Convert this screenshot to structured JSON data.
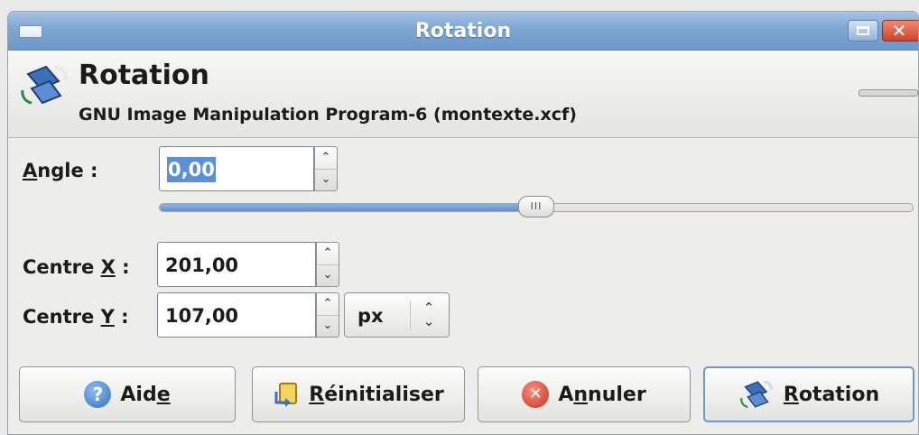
{
  "window": {
    "title": "Rotation",
    "close_glyph": "✕"
  },
  "header": {
    "title": "Rotation",
    "subtitle": "GNU Image Manipulation Program-6 (montexte.xcf)",
    "icon": "rotate-tool-icon"
  },
  "angle": {
    "label_mnemonic": "A",
    "label_rest": "ngle :",
    "value": "0,00",
    "slider_fraction": 0.5,
    "slider_grip": "III"
  },
  "centre_x": {
    "label_prefix": "Centre ",
    "label_mnemonic": "X",
    "label_suffix": " :",
    "value": "201,00"
  },
  "centre_y": {
    "label_prefix": "Centre ",
    "label_mnemonic": "Y",
    "label_suffix": " :",
    "value": "107,00"
  },
  "unit": {
    "value": "px"
  },
  "spin": {
    "up": "⌃",
    "down": "⌄",
    "updown": "⌃⌄"
  },
  "buttons": {
    "help": {
      "prefix": "Aid",
      "mnemonic": "e",
      "suffix": "",
      "icon": "help-icon",
      "icon_glyph": "?"
    },
    "reset": {
      "prefix": "",
      "mnemonic": "R",
      "suffix": "éinitialiser",
      "icon": "reset-icon"
    },
    "cancel": {
      "prefix": "A",
      "mnemonic": "n",
      "suffix": "nuler",
      "icon": "cancel-icon",
      "icon_glyph": "✕"
    },
    "rotate": {
      "prefix": "",
      "mnemonic": "R",
      "suffix": "otation",
      "icon": "rotate-tool-icon"
    }
  },
  "colors": {
    "titlebar": "#7ea6d2",
    "accent": "#5b8fd8",
    "close": "#d0422a"
  }
}
